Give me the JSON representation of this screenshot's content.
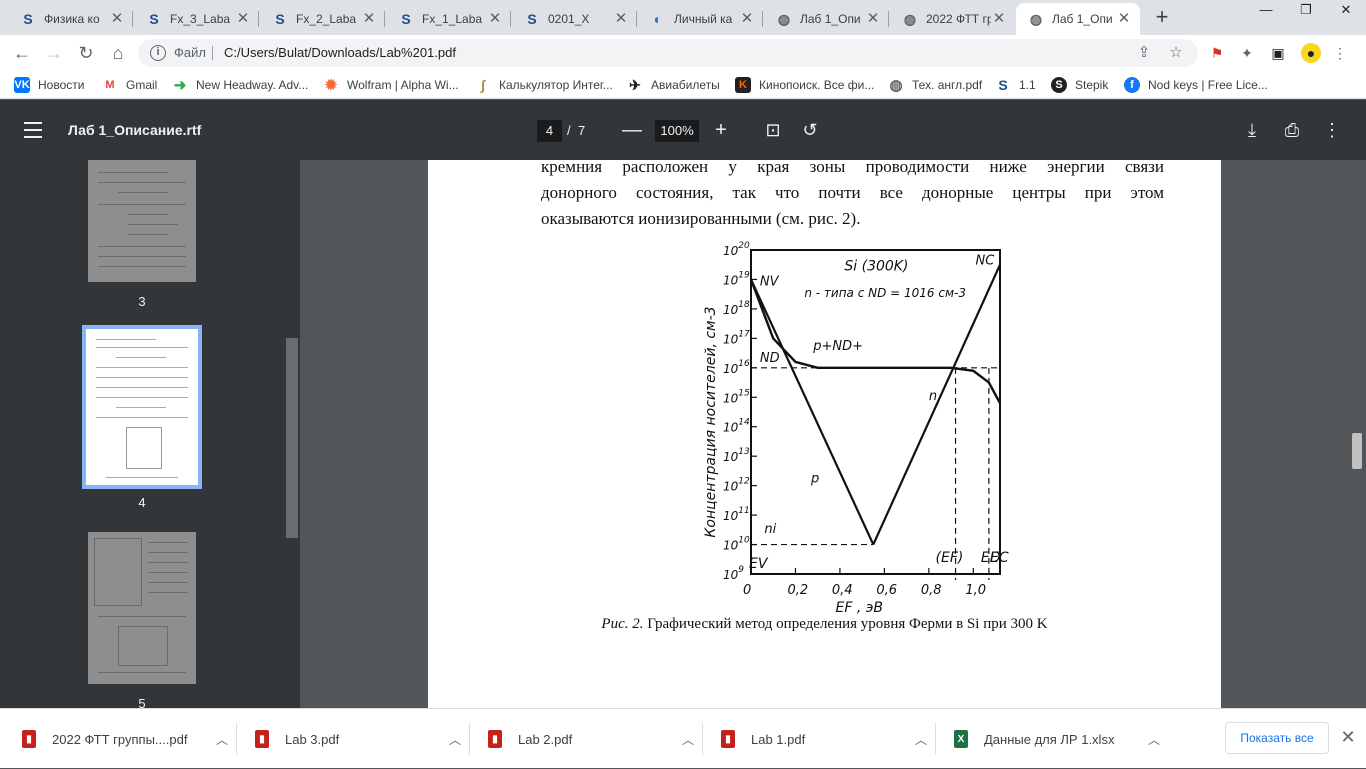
{
  "tabs": [
    {
      "title": "Физика ко",
      "icon": "stepik-icon",
      "color": "#1e4e8c"
    },
    {
      "title": "Fx_3_Laba",
      "icon": "stepik-icon",
      "color": "#1e4e8c"
    },
    {
      "title": "Fx_2_Laba",
      "icon": "stepik-icon",
      "color": "#1e4e8c"
    },
    {
      "title": "Fx_1_Laba",
      "icon": "stepik-icon",
      "color": "#1e4e8c"
    },
    {
      "title": "0201_X",
      "icon": "stepik-icon",
      "color": "#1e4e8c"
    },
    {
      "title": "Личный ка",
      "icon": "edge-icon",
      "color": "#2b6cb0"
    },
    {
      "title": "Лаб 1_Опи",
      "icon": "globe-icon",
      "color": "#5f6368"
    },
    {
      "title": "2022 ФТТ гр",
      "icon": "globe-icon",
      "color": "#5f6368"
    },
    {
      "title": "Лаб 1_Опи",
      "icon": "globe-icon",
      "color": "#5f6368"
    }
  ],
  "address": {
    "scheme_label": "Файл",
    "url": "C:/Users/Bulat/Downloads/Lab%201.pdf"
  },
  "bookmarks": [
    {
      "label": "Новости",
      "icon": "vk-icon",
      "color": "#0077ff",
      "glyph": "VK"
    },
    {
      "label": "Gmail",
      "icon": "gmail-icon",
      "color": "#ea4335",
      "glyph": "M"
    },
    {
      "label": "New Headway. Adv...",
      "icon": "arrow-icon",
      "color": "#34a853",
      "glyph": "➜"
    },
    {
      "label": "Wolfram | Alpha Wi...",
      "icon": "wolfram-icon",
      "color": "#f96932",
      "glyph": "✹"
    },
    {
      "label": "Калькулятор Интег...",
      "icon": "calc-icon",
      "color": "#b08850",
      "glyph": "∫"
    },
    {
      "label": "Авиабилеты",
      "icon": "plane-icon",
      "color": "#202124",
      "glyph": "✈"
    },
    {
      "label": "Кинопоиск. Все фи...",
      "icon": "kinopoisk-icon",
      "color": "#ff6600",
      "glyph": "K"
    },
    {
      "label": "Тех. англ.pdf",
      "icon": "globe-icon",
      "color": "#5f6368",
      "glyph": "◍"
    },
    {
      "label": "1.1",
      "icon": "stepik-icon",
      "color": "#1e4e8c",
      "glyph": "S"
    },
    {
      "label": "Stepik",
      "icon": "stepik-icon",
      "color": "#202124",
      "glyph": "S"
    },
    {
      "label": "Nod keys | Free Lice...",
      "icon": "facebook-icon",
      "color": "#1877f2",
      "glyph": "f"
    }
  ],
  "pdf": {
    "title": "Лаб 1_Описание.rtf",
    "current_page": "4",
    "page_separator": "/",
    "total_pages": "7",
    "zoom": "100%"
  },
  "thumbnails": {
    "page_3": "3",
    "page_4": "4",
    "page_5": "5"
  },
  "document": {
    "line1": "кремния расположен у края зоны проводимости ниже энергии связи",
    "line2": "донорного состояния, так что почти все донорные центры при этом",
    "line3": "оказываются ионизированными (см. рис. 2).",
    "caption_prefix": "Рис. 2.",
    "caption_text": " Графический метод определения уровня Ферми в Si при 300 K"
  },
  "chart_data": {
    "type": "line",
    "title": "Si (300K)",
    "subtitle": "n - типа с N_D = 10^16 см^-3",
    "xlabel": "E_F , эВ",
    "ylabel": "Концентрация носителей, см^-3",
    "yscale": "log",
    "xlim": [
      0,
      1.12
    ],
    "ylim_exp": [
      9,
      20
    ],
    "x_ticks": [
      "0",
      "0,2",
      "0,4",
      "0,6",
      "0,8",
      "1,0"
    ],
    "y_tick_labels": [
      "10^9",
      "10^10",
      "10^11",
      "10^12",
      "10^13",
      "10^14",
      "10^15",
      "10^16",
      "10^17",
      "10^18",
      "10^19",
      "10^20"
    ],
    "level_markers": [
      "E_V",
      "(E_F)",
      "E_D",
      "E_C"
    ],
    "level_positions_ev": {
      "E_V": 0,
      "E_F": 0.92,
      "E_D": 1.07,
      "E_C": 1.12
    },
    "intrinsic_label": "n_i",
    "intrinsic_log": 10,
    "series": [
      {
        "name": "p",
        "log_values": [
          [
            0,
            19.0
          ],
          [
            0.55,
            10.0
          ]
        ]
      },
      {
        "name": "n",
        "log_values": [
          [
            0.55,
            10.0
          ],
          [
            1.12,
            19.5
          ]
        ]
      },
      {
        "name": "p+N_D^+",
        "log_values": [
          [
            0,
            19.0
          ],
          [
            0.1,
            17.0
          ],
          [
            0.2,
            16.2
          ],
          [
            0.3,
            16.0
          ],
          [
            0.9,
            16.0
          ],
          [
            1.0,
            15.9
          ],
          [
            1.07,
            15.5
          ],
          [
            1.12,
            14.8
          ]
        ]
      },
      {
        "name": "N_D",
        "log_values": [
          [
            0,
            16.0
          ],
          [
            1.12,
            16.0
          ]
        ]
      }
    ],
    "labels": {
      "Nv": "N_V",
      "Nc": "N_C",
      "Nd": "N_D",
      "p_curve": "p",
      "n_curve": "n",
      "sum_curve": "p+N_D^+"
    }
  },
  "downloads": [
    {
      "name": "2022 ФТТ группы....pdf",
      "icon": "pdf-file-icon",
      "color": "#c5221f",
      "glyph": "▮"
    },
    {
      "name": "Lab 3.pdf",
      "icon": "pdf-file-icon",
      "color": "#c5221f",
      "glyph": "▮"
    },
    {
      "name": "Lab 2.pdf",
      "icon": "pdf-file-icon",
      "color": "#c5221f",
      "glyph": "▮"
    },
    {
      "name": "Lab 1.pdf",
      "icon": "pdf-file-icon",
      "color": "#c5221f",
      "glyph": "▮"
    },
    {
      "name": "Данные для ЛР 1.xlsx",
      "icon": "excel-file-icon",
      "color": "#1e7145",
      "glyph": "X"
    }
  ],
  "downloads_bar": {
    "show_all": "Показать все"
  }
}
